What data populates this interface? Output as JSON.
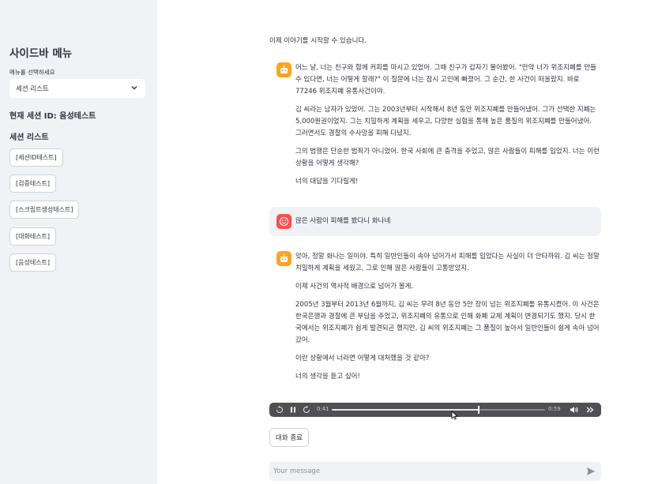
{
  "sidebar": {
    "title": "사이드바 메뉴",
    "select_label": "메뉴를 선택하세요",
    "select_value": "세션 리스트",
    "current_session": "현재 세션 ID: 음성테스트",
    "list_title": "세션 리스트",
    "sessions": [
      "[세션ID테스트]",
      "[검증테스트]",
      "[스크립트생성테스트]",
      "[대화테스트]",
      "[음성테스트]"
    ]
  },
  "chat": {
    "intro": "이제 이야기를 시작할 수 있습니다.",
    "messages": [
      {
        "role": "assistant",
        "paragraphs": [
          "어느 날, 너는 친구와 함께 커피를 마시고 있었어. 그때 친구가 갑자기 물어봤어. \"만약 너가 위조지폐를 만들 수 있다면, 너는 어떻게 할래?\" 이 질문에 너는 잠시 고민에 빠졌어. 그 순간, 한 사건이 떠올랐지. 바로 77246 위조지폐 유통사건이야.",
          "김 씨라는 남자가 있었어. 그는 2003년부터 시작해서 8년 동안 위조지폐를 만들어냈어. 그가 선택한 지폐는 5,000원권이었지. 그는 치밀하게 계획을 세우고, 다양한 실험을 통해 높은 품질의 위조지폐를 만들어냈어. 그러면서도 경찰의 수사망을 피해 다녔지.",
          "그의 범행은 단순한 범죄가 아니었어. 한국 사회에 큰 충격을 주었고, 많은 사람들이 피해를 입었지. 너는 이런 상황을 어떻게 생각해?",
          "너의 대답을 기다릴게!"
        ]
      },
      {
        "role": "user",
        "paragraphs": [
          "많은 사람이 피해를 봤다니 화나네"
        ]
      },
      {
        "role": "assistant",
        "paragraphs": [
          "맞아, 정말 화나는 일이야. 특히 일반인들이 속아 넘어가서 피해를 입었다는 사실이 더 안타까워. 김 씨는 정말 치밀하게 계획을 세웠고, 그로 인해 많은 사람들이 고통받았지.",
          "이제 사건의 역사적 배경으로 넘어가 볼게.",
          "2005년 3월부터 2013년 6월까지, 김 씨는 무려 8년 동안 5만 장이 넘는 위조지폐를 유통시켰어. 이 사건은 한국은행과 경찰에 큰 부담을 주었고, 위조지폐의 유통으로 인해 화폐 교체 계획이 변경되기도 했지. 당시 한국에서는 위조지폐가 쉽게 발견되곤 했지만, 김 씨의 위조지폐는 그 품질이 높아서 일반인들이 쉽게 속아 넘어갔어.",
          "이런 상황에서 너라면 어떻게 대처했을 것 같아?",
          "너의 생각을 듣고 싶어!"
        ]
      }
    ],
    "audio": {
      "current": "0:41",
      "duration": "0:59",
      "progress": 0.69
    },
    "end_button": "대화 종료",
    "input_placeholder": "Your message"
  },
  "icons": {
    "assistant_avatar": "robot-face-icon",
    "user_avatar": "smiley-face-icon",
    "send": "send-arrow-icon",
    "select": "chevron-down-icon"
  },
  "colors": {
    "sidebar_bg": "#f0f2f6",
    "assistant_avatar": "#ffa421",
    "user_avatar": "#ff4b4b",
    "audio_bg": "#4f4f54"
  }
}
